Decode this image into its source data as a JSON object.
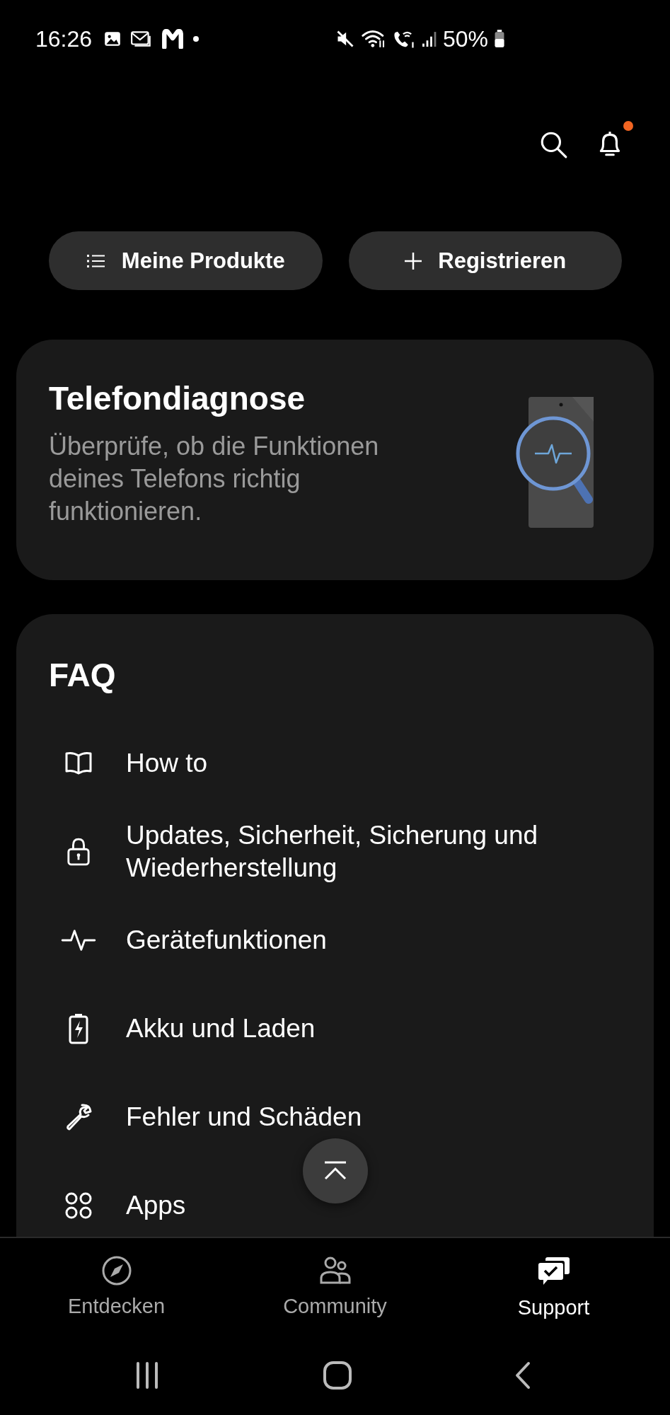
{
  "status_bar": {
    "time": "16:26",
    "battery": "50%"
  },
  "header": {
    "has_notification": true
  },
  "actions": [
    {
      "kind": "list",
      "label": "Meine Produkte"
    },
    {
      "kind": "add",
      "label": "Registrieren"
    }
  ],
  "diagnosis_card": {
    "title": "Telefondiagnose",
    "description": "Überprüfe, ob die Funktionen deines Telefons richtig funktionieren."
  },
  "faq": {
    "title": "FAQ",
    "items": [
      {
        "kind": "book",
        "label": "How to"
      },
      {
        "kind": "lock",
        "label": "Updates, Sicherheit, Sicherung und Wiederherstellung"
      },
      {
        "kind": "pulse",
        "label": "Gerätefunktionen"
      },
      {
        "kind": "battery",
        "label": "Akku und Laden"
      },
      {
        "kind": "wrench",
        "label": "Fehler und Schäden"
      },
      {
        "kind": "apps",
        "label": "Apps"
      }
    ]
  },
  "bottom_nav": [
    {
      "kind": "compass",
      "label": "Entdecken",
      "selected": false
    },
    {
      "kind": "people",
      "label": "Community",
      "selected": false
    },
    {
      "kind": "chat",
      "label": "Support",
      "selected": true
    }
  ]
}
